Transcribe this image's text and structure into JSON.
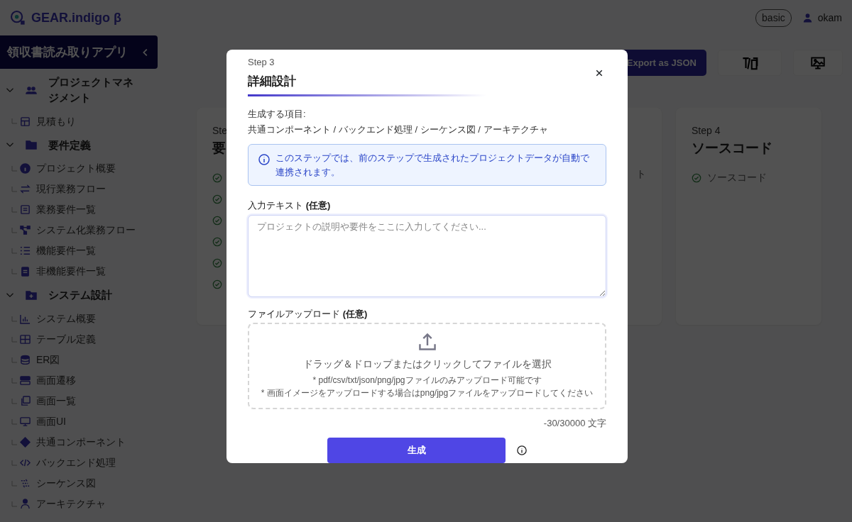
{
  "header": {
    "logo": "GEAR.indigo β",
    "plan": "basic",
    "user": "okam"
  },
  "sidebar": {
    "project": "領収書読み取りアプリ",
    "groups": [
      {
        "label": "プロジェクトマネジメント",
        "expanded": true,
        "items": [
          {
            "label": "見積もり"
          }
        ]
      },
      {
        "label": "要件定義",
        "expanded": true,
        "items": [
          {
            "label": "プロジェクト概要"
          },
          {
            "label": "現行業務フロー"
          },
          {
            "label": "業務要件一覧"
          },
          {
            "label": "システム化業務フロー"
          },
          {
            "label": "機能要件一覧"
          },
          {
            "label": "非機能要件一覧"
          }
        ]
      },
      {
        "label": "システム設計",
        "expanded": true,
        "items": [
          {
            "label": "システム概要"
          },
          {
            "label": "テーブル定義"
          },
          {
            "label": "ER図"
          },
          {
            "label": "画面遷移"
          },
          {
            "label": "画面一覧"
          },
          {
            "label": "画面UI"
          },
          {
            "label": "共通コンポーネント"
          },
          {
            "label": "バックエンド処理"
          },
          {
            "label": "シーケンス図"
          },
          {
            "label": "アーキテクチャ"
          }
        ]
      }
    ]
  },
  "toolbar": {
    "export": "Export as JSON"
  },
  "steps": [
    {
      "step": "Ste",
      "title": "要",
      "items": [
        {
          "done": true
        },
        {
          "done": true
        },
        {
          "done": true
        },
        {
          "done": true
        },
        {
          "done": true
        },
        {
          "done": true
        }
      ]
    },
    {
      "items": [
        {
          "label": "ト"
        }
      ]
    },
    {
      "step": "Step 4",
      "title": "ソースコード",
      "items": [
        {
          "label": "ソースコード",
          "done": true
        }
      ]
    }
  ],
  "modal": {
    "step": "Step 3",
    "title": "詳細設計",
    "items_label": "生成する項目:",
    "items": "共通コンポーネント / バックエンド処理 / シーケンス図 / アーキテクチャ",
    "info": "このステップでは、前のステップで生成されたプロジェクトデータが自動で連携されます。",
    "text_field": {
      "label": "入力テキスト **(任意)**",
      "placeholder": "プロジェクトの説明や要件をここに入力してください..."
    },
    "upload": {
      "label": "ファイルアップロード **(任意)**",
      "prompt": "ドラッグ＆ドロップまたはクリックしてファイルを選択",
      "notes": [
        "* pdf/csv/txt/json/png/jpgファイルのみアップロード可能です",
        "* 画面イメージをアップロードする場合はpng/jpgファイルをアップロードしてください"
      ]
    },
    "counter": "-30/30000 文字",
    "generate": "生成"
  }
}
